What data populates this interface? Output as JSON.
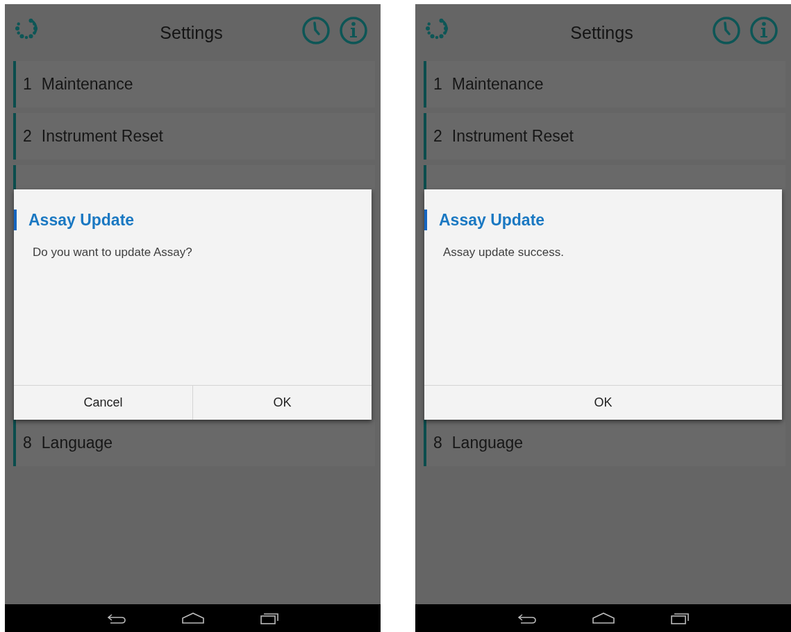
{
  "screens": [
    {
      "header": {
        "title": "Settings"
      },
      "menu_items": [
        {
          "number": "1",
          "label": "Maintenance"
        },
        {
          "number": "2",
          "label": "Instrument Reset"
        },
        {
          "number": "8",
          "label": "Language"
        }
      ],
      "dialog": {
        "title": "Assay Update",
        "message": "Do you want to update Assay?",
        "buttons": [
          "Cancel",
          "OK"
        ]
      }
    },
    {
      "header": {
        "title": "Settings"
      },
      "menu_items": [
        {
          "number": "1",
          "label": "Maintenance"
        },
        {
          "number": "2",
          "label": "Instrument Reset"
        },
        {
          "number": "8",
          "label": "Language"
        }
      ],
      "dialog": {
        "title": "Assay Update",
        "message": "Assay update success.",
        "buttons": [
          "OK"
        ]
      }
    }
  ]
}
